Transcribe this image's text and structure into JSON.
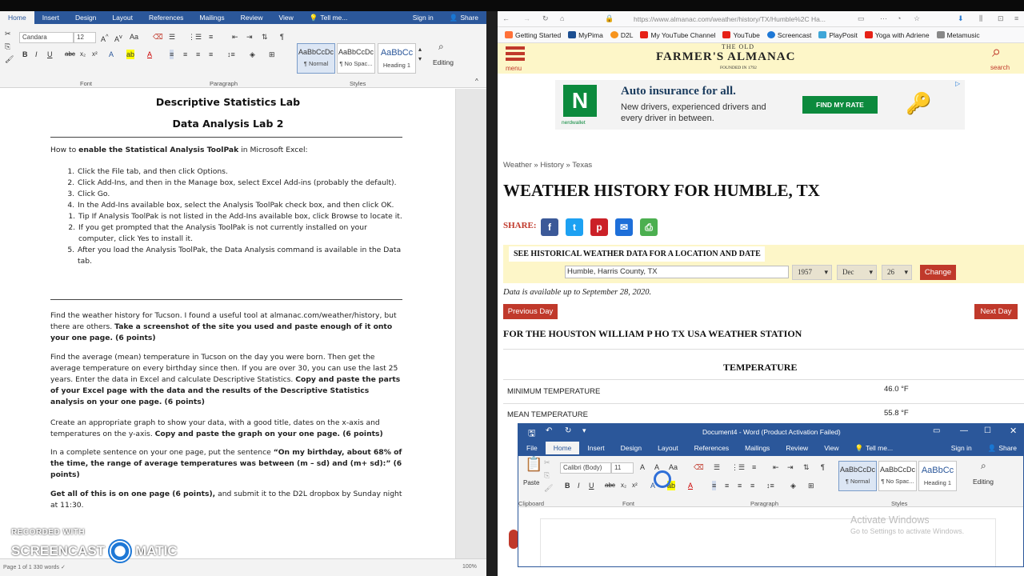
{
  "word_left": {
    "tabs": [
      "Home",
      "Insert",
      "Design",
      "Layout",
      "References",
      "Mailings",
      "Review",
      "View",
      "Tell me..."
    ],
    "active_tab": "Home",
    "sign_in": "Sign in",
    "share": "Share",
    "font_name": "Candara",
    "font_size": "12",
    "groups": {
      "font": "Font",
      "paragraph": "Paragraph",
      "styles": "Styles"
    },
    "styles": [
      {
        "preview": "AaBbCcDc",
        "name": "¶ Normal"
      },
      {
        "preview": "AaBbCcDc",
        "name": "¶ No Spac..."
      },
      {
        "preview": "AaBbCc",
        "name": "Heading 1"
      }
    ],
    "editing": "Editing",
    "doc": {
      "title1": "Descriptive Statistics Lab",
      "title2": "Data Analysis Lab 2",
      "intro_pre": "How to ",
      "intro_bold": "enable the Statistical Analysis ToolPak",
      "intro_post": " in Microsoft Excel:",
      "steps": [
        "Click the File tab, and then click Options.",
        "Click Add-Ins, and then in the Manage box, select Excel Add-ins (probably the default).",
        "Click Go.",
        "In the Add-Ins available box, select the Analysis ToolPak check box, and then click OK.",
        "After you load the Analysis ToolPak, the Data Analysis command is available in the Data tab."
      ],
      "substeps": [
        "Tip    If Analysis ToolPak is not listed in the Add-Ins available box, click Browse to locate it.",
        "If you get prompted that the Analysis ToolPak is not currently installed on your computer, click Yes to install it."
      ],
      "p1_pre": "Find the weather history for Tucson.  I found a useful tool at almanac.com/weather/history, but there are others.  ",
      "p1_bold": "Take a screenshot of the site you used and paste enough of it onto your one page. (6 points)",
      "p2_pre": "Find the average (mean) temperature in Tucson on the day you were born.  Then get the average temperature on every birthday since then.  If you are over 30, you can use the last 25 years.  Enter the data in Excel and calculate Descriptive Statistics.  ",
      "p2_bold": "Copy and paste the parts of your Excel page with the data and the results of the Descriptive Statistics analysis on your one page.  (6 points)",
      "p3_pre": "Create an appropriate graph to show your data, with a good title, dates on the x-axis and temperatures on the y-axis.  ",
      "p3_bold": "Copy and paste the graph on your one page.  (6 points)",
      "p4_pre": "In a complete sentence on your one page, put the sentence ",
      "p4_bold": "“On my birthday, about 68% of the time, the range of average temperatures was between (m – sd) and (m+ sd):” (6 points)",
      "p5_bold": "Get all of this is on one page (6 points),",
      "p5_post": " and submit it to the D2L dropbox by Sunday night at 11:30."
    },
    "status_left": "Page 1 of 1   330 words   ✓",
    "zoom": "100%"
  },
  "browser": {
    "url": "https://www.almanac.com/weather/history/TX/Humble%2C Ha...",
    "bookmarks": [
      "Getting Started",
      "MyPima",
      "D2L",
      "My YouTube Channel",
      "YouTube",
      "Screencast",
      "PlayPosit",
      "Yoga with Adriene",
      "Metamusic"
    ],
    "menu_label": "menu",
    "search_label": "search",
    "logo_top": "THE OLD",
    "logo_main": "FARMER'S ALMANAC",
    "logo_sub": "FOUNDED IN 1792",
    "ad": {
      "headline": "Auto insurance for all.",
      "body": "New drivers, experienced drivers and every driver in between.",
      "cta": "FIND MY RATE",
      "brand": "nerdwallet"
    },
    "breadcrumb": [
      "Weather",
      "»",
      "History",
      "»",
      "Texas"
    ],
    "page_title": "WEATHER HISTORY FOR HUMBLE, TX",
    "share_label": "SHARE:",
    "share_icons": [
      "f",
      "t",
      "p",
      "✉",
      "⎙"
    ],
    "search_box_title": "SEE HISTORICAL WEATHER DATA FOR A LOCATION AND DATE",
    "location_value": "Humble, Harris County, TX",
    "year": "1957",
    "month": "Dec",
    "day": "26",
    "change_button": "Change",
    "availability": "Data is available up to September 28, 2020.",
    "prev_day": "Previous Day",
    "next_day": "Next Day",
    "station": "FOR THE HOUSTON WILLIAM P HO TX USA WEATHER STATION",
    "temp_heading": "TEMPERATURE",
    "min_label": "MINIMUM TEMPERATURE",
    "min_value": "46.0 °F",
    "mean_label": "MEAN TEMPERATURE",
    "mean_value": "55.8 °F"
  },
  "word_small": {
    "title": "Document4 - Word (Product Activation Failed)",
    "tabs": [
      "File",
      "Home",
      "Insert",
      "Design",
      "Layout",
      "References",
      "Mailings",
      "Review",
      "View",
      "Tell me..."
    ],
    "active_tab": "Home",
    "sign_in": "Sign in",
    "share": "Share",
    "font_name": "Calibri (Body)",
    "font_size": "11",
    "paste": "Paste",
    "groups": {
      "clipboard": "Clipboard",
      "font": "Font",
      "paragraph": "Paragraph",
      "styles": "Styles"
    },
    "styles": [
      {
        "preview": "AaBbCcDc",
        "name": "¶ Normal"
      },
      {
        "preview": "AaBbCcDc",
        "name": "¶ No Spac..."
      },
      {
        "preview": "AaBbCc",
        "name": "Heading 1"
      }
    ],
    "editing": "Editing"
  },
  "watermark": {
    "title": "Activate Windows",
    "sub": "Go to Settings to activate Windows."
  },
  "screencast": {
    "recorded": "RECORDED WITH",
    "brand_left": "SCREENCAST",
    "brand_right": "MATIC"
  },
  "colors": {
    "word_blue": "#2b579a",
    "almanac_red": "#c0392b",
    "almanac_header": "#fdf6c8",
    "facebook": "#3b5998",
    "twitter": "#1da1f2",
    "pinterest": "#cb2027",
    "email": "#1e6fd9",
    "print": "#4caf50"
  }
}
